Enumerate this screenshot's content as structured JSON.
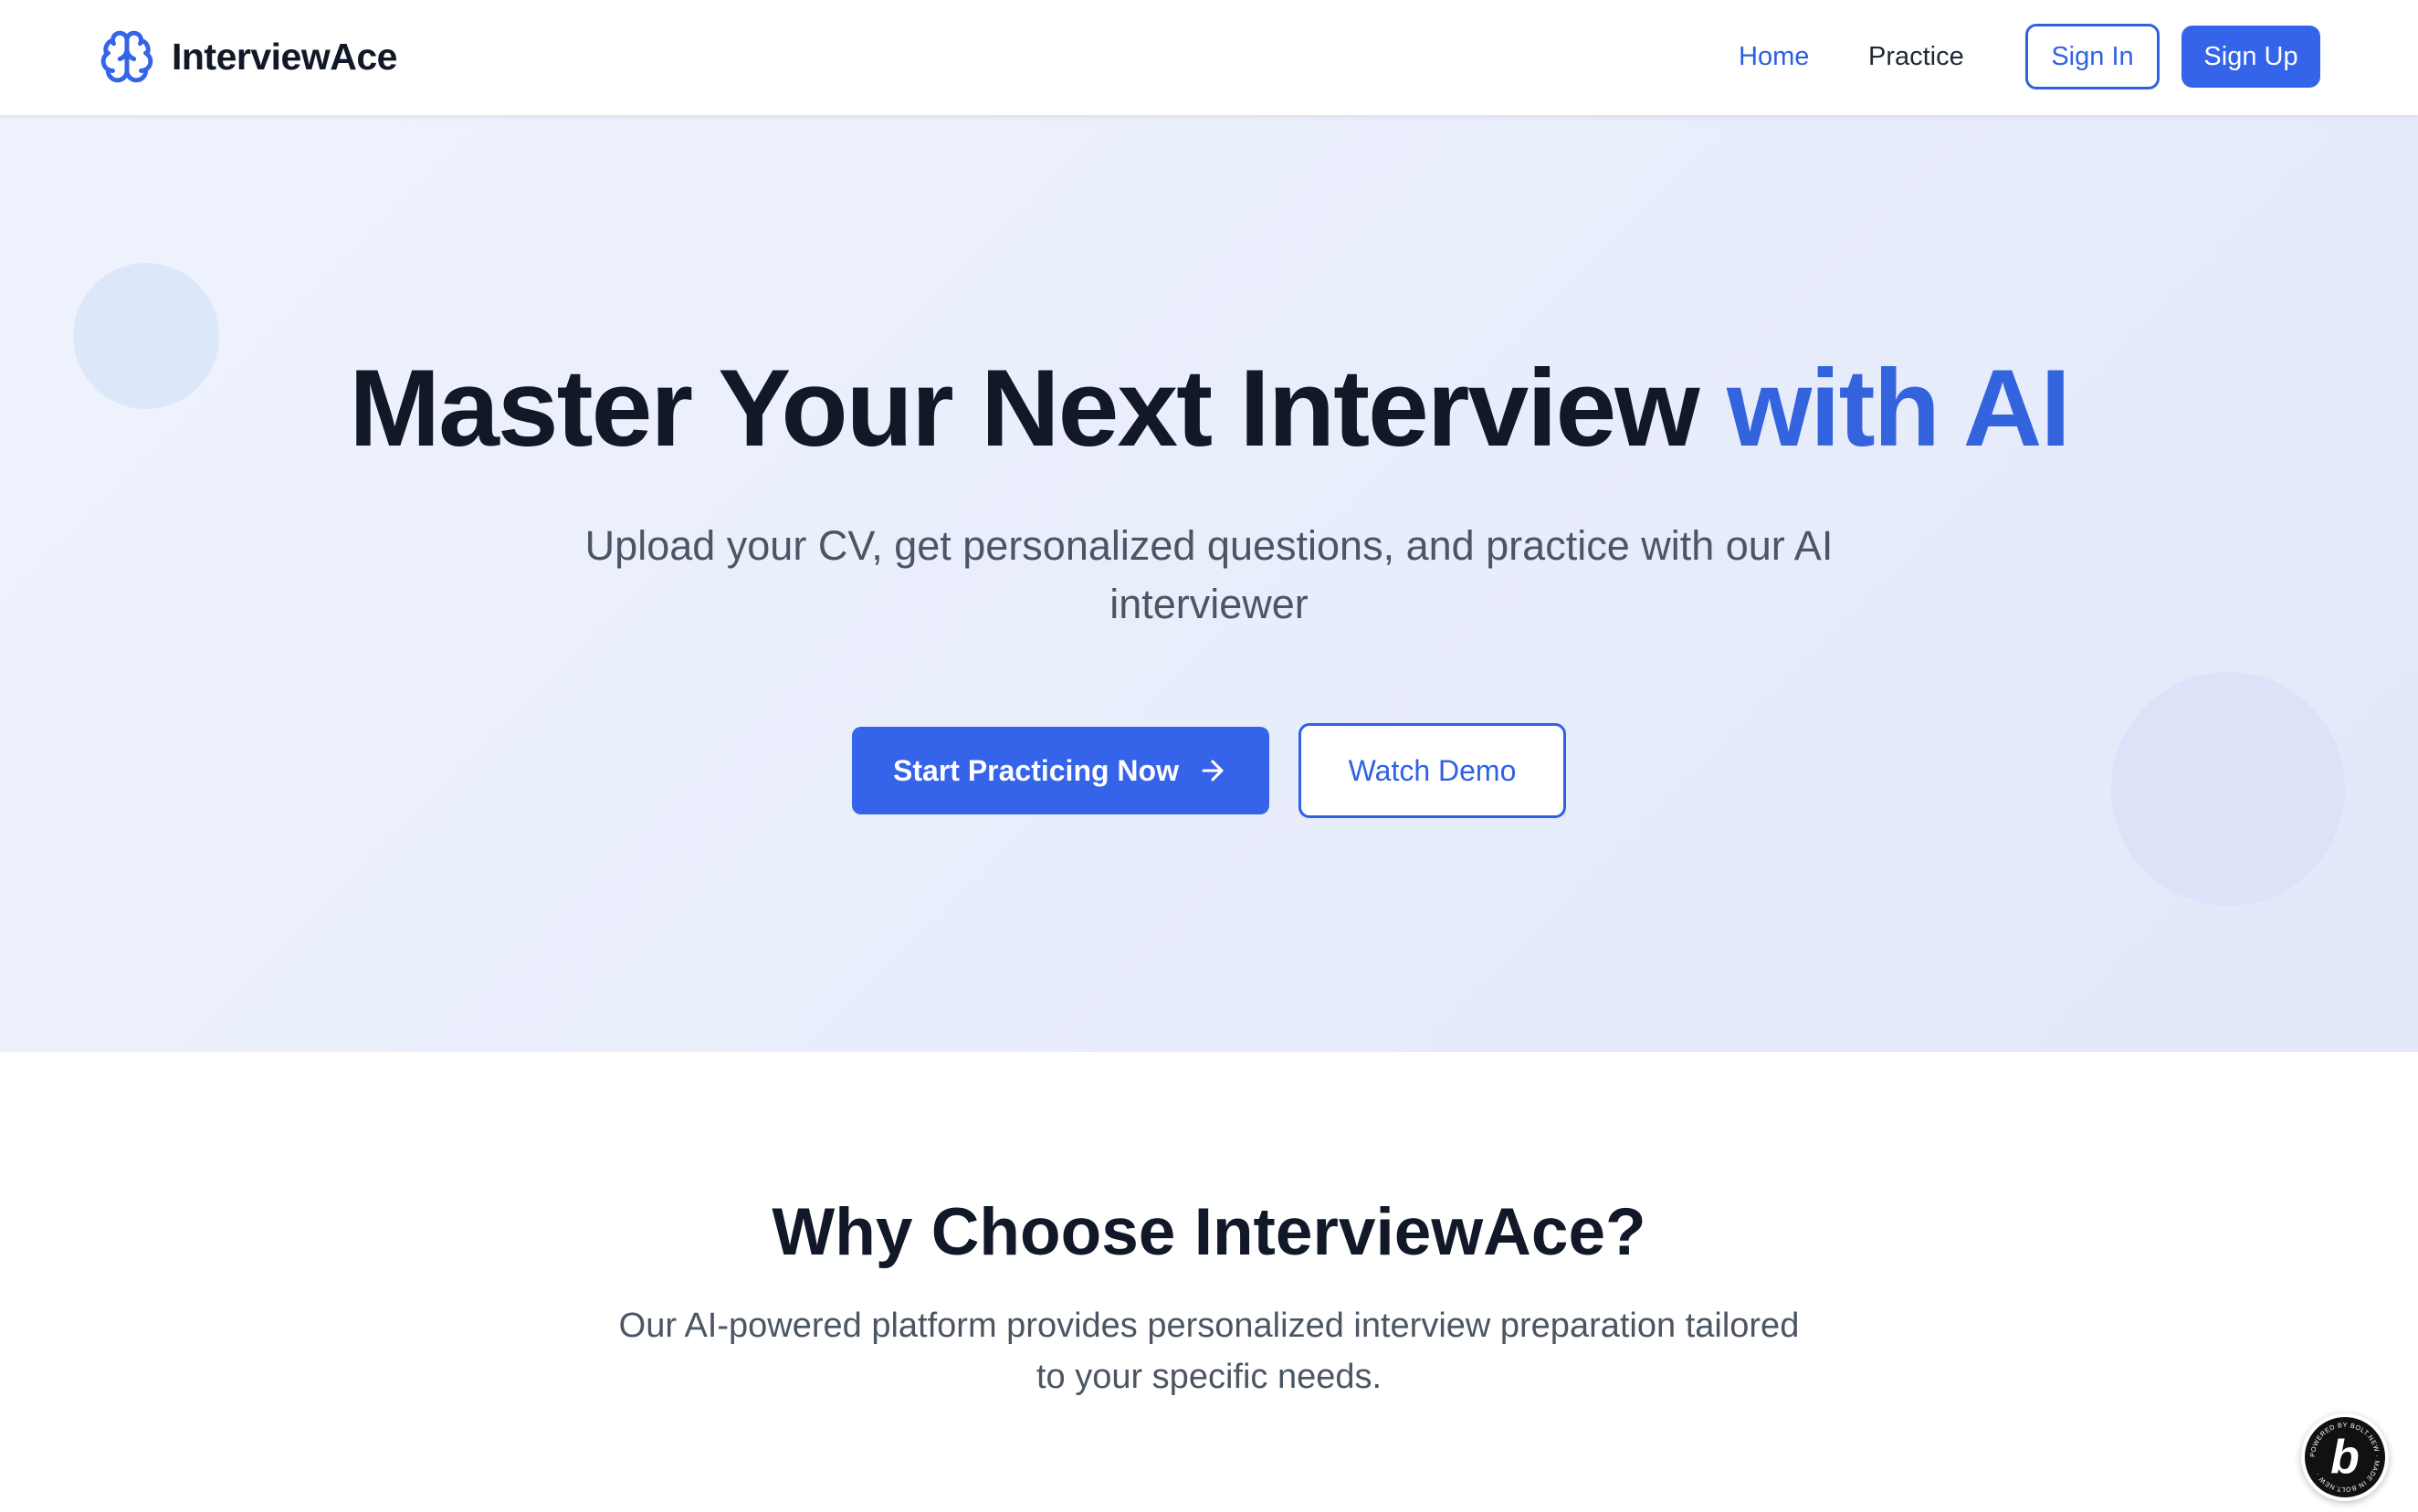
{
  "app": {
    "brand": "InterviewAce",
    "brand_icon": "brain-icon",
    "accent_color": "#3563e9"
  },
  "nav": {
    "links": [
      {
        "label": "Home",
        "active": true
      },
      {
        "label": "Practice",
        "active": false
      }
    ],
    "sign_in": "Sign In",
    "sign_up": "Sign Up"
  },
  "hero": {
    "title_main": "Master Your Next Interview ",
    "title_accent": "with AI",
    "subtitle": "Upload your CV, get personalized questions, and practice with our AI interviewer",
    "primary_cta": "Start Practicing Now",
    "primary_cta_icon": "arrow-right-icon",
    "secondary_cta": "Watch Demo"
  },
  "why": {
    "title": "Why Choose InterviewAce?",
    "subtitle": "Our AI-powered platform provides personalized interview preparation tailored to your specific needs."
  },
  "badge": {
    "letter": "b",
    "ring_text": "POWERED BY BOLT.NEW · MADE IN BOLT.NEW ·"
  }
}
